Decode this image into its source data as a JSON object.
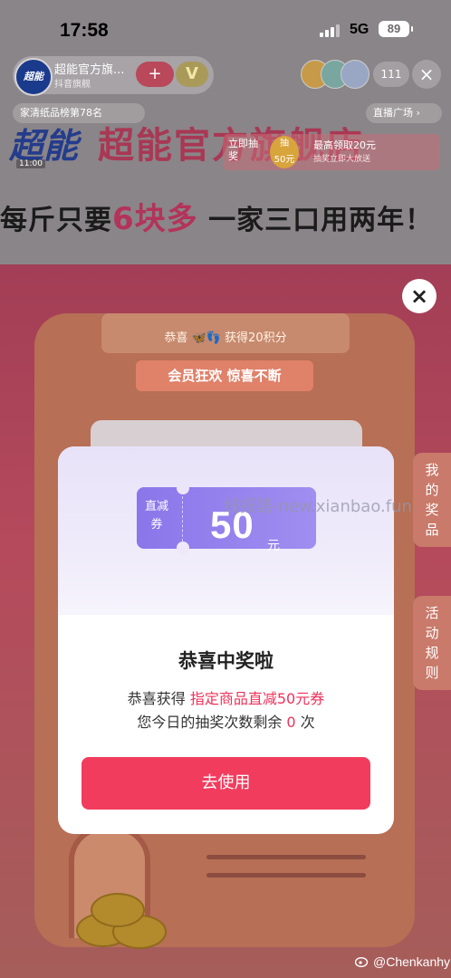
{
  "status_bar": {
    "time": "17:58",
    "network": "5G",
    "battery": "89"
  },
  "store": {
    "logo_text": "超能",
    "name": "超能官方旗...",
    "subtitle": "抖音旗舰",
    "follow_label": "+",
    "v_label": "V",
    "viewer_count": "111",
    "close_label": "×",
    "rank_label": "家清纸品榜第78名",
    "plaza_label": "直播广场 ›",
    "brand_text": "超能",
    "brand_time": "11:00",
    "title": "超能官方旗舰店"
  },
  "lottery_card": {
    "text_a": "立即抽奖",
    "coin_text": "抽",
    "coin_sub": "50元",
    "text_b": "最高领取20元",
    "text_c": "抽奖立即大放送"
  },
  "banner": {
    "prefix": "每斤只要",
    "highlight": "6块多",
    "suffix": " 一家三口用两年！"
  },
  "game": {
    "top_text": "恭喜 🦋👣 获得20积分",
    "sign_text": "会员狂欢 惊喜不断",
    "close_label": "×",
    "side_tabs": {
      "prize": "我的奖品",
      "rules": "活动规则"
    }
  },
  "modal": {
    "coupon_label": "直减券",
    "coupon_amount": "50",
    "coupon_unit": "元",
    "watermark": "线报酷-new.xianbao.fun",
    "title": "恭喜中奖啦",
    "line1_prefix": "恭喜获得 ",
    "line1_highlight": "指定商品直减50元券",
    "line2_prefix": "您今日的抽奖次数剩余 ",
    "line2_highlight": "0",
    "line2_suffix": " 次",
    "button_label": "去使用"
  },
  "credit": "@Chenkanhy",
  "colors": {
    "accent": "#f23c5e",
    "coupon": "#8b76ea",
    "highlight": "#f0315a"
  }
}
